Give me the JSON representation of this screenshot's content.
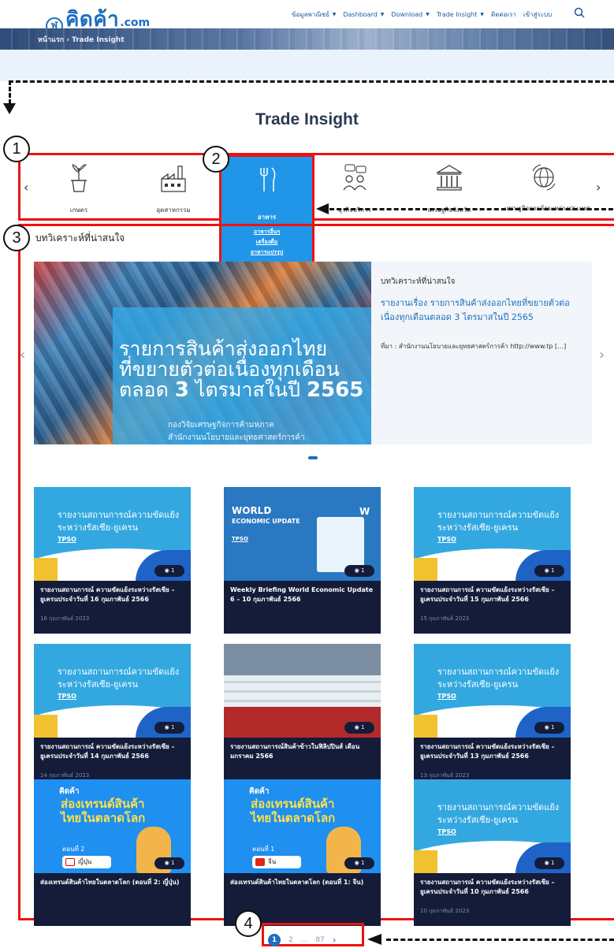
{
  "header": {
    "logo_mark": "ฬ",
    "logo_name": "คิดค้า",
    "logo_domain": ".com",
    "nav": [
      {
        "label": "ข้อมูลพาณิชย์",
        "has_caret": true
      },
      {
        "label": "Dashboard",
        "has_caret": true
      },
      {
        "label": "Download",
        "has_caret": true
      },
      {
        "label": "Trade Insight",
        "has_caret": true
      },
      {
        "label": "ติดต่อเรา",
        "has_caret": false
      },
      {
        "label": "เข้าสู่ระบบ",
        "has_caret": false
      }
    ],
    "search_icon": "search-icon"
  },
  "breadcrumb": {
    "home": "หน้าแรก",
    "sep": "›",
    "current": "Trade Insight"
  },
  "page_title": "Trade Insight",
  "categories": {
    "items": [
      {
        "label": "เกษตร",
        "icon": "plant-icon"
      },
      {
        "label": "อุตสาหกรรม",
        "icon": "factory-icon"
      },
      {
        "label": "อาหาร",
        "icon": "fork-knife-icon",
        "active": true,
        "subitems": [
          "อาหารอื่นๆ",
          "เครื่องดื่ม",
          "อาหารแปรรูป"
        ]
      },
      {
        "label": "ธุรกิจบริการ",
        "icon": "people-chat-icon"
      },
      {
        "label": "เศรษฐกิจจังหวัด",
        "icon": "building-icon"
      },
      {
        "label": "เศรษฐกิจการค้าระหว่างประเทศ",
        "icon": "globe-icon"
      }
    ],
    "prev": "‹",
    "next": "›"
  },
  "annotations": {
    "b1": "1",
    "b2": "2",
    "b3": "3",
    "b4": "4"
  },
  "section_title": "บทวิเคราะห์ที่น่าสนใจ",
  "hero": {
    "line1": "รายการสินค้าส่งออกไทย",
    "line2": "ที่ขยายตัวต่อเนื่องทุกเดือน",
    "line3_pre": "ตลอด ",
    "line3_num": "3",
    "line3_mid": " ไตรมาสในปี ",
    "line3_year": "2565",
    "sub1": "กองวิจัยเศรษฐกิจการค้ามหภาค",
    "sub2": "สำนักงานนโยบายและยุทธศาสตร์การค้า",
    "kicker": "บทวิเคราะห์ที่น่าสนใจ",
    "headline": "รายงานเรื่อง รายการสินค้าส่งออกไทยที่ขยายตัวต่อเนื่องทุกเดือนตลอด 3 ไตรมาสในปี 2565",
    "source": "ที่มา : สำนักงานนโยบายและยุทธศาสตร์การค้า http://www.tp […]",
    "prev": "‹",
    "next": "›"
  },
  "cards": [
    {
      "type": "blue",
      "thumb_line1": "รายงานสถานการณ์ความขัดแย้ง",
      "thumb_line2": "ระหว่างรัสเซีย-ยูเครน",
      "thumb_tag": "TPSO",
      "views": "1",
      "title": "รายงานสถานการณ์ ความขัดแย้งระหว่างรัสเซีย – ยูเครนประจำวันที่ 16 กุมภาพันธ์ 2566",
      "date": "16 กุมภาพันธ์ 2023"
    },
    {
      "type": "world",
      "thumb_line1": "WORLD",
      "thumb_line2": "ECONOMIC UPDATE",
      "thumb_tag": "TPSO",
      "views": "1",
      "title": "Weekly Briefing World Economic Update 6 – 10 กุมภาพันธ์ 2566",
      "date": ""
    },
    {
      "type": "blue",
      "thumb_line1": "รายงานสถานการณ์ความขัดแย้ง",
      "thumb_line2": "ระหว่างรัสเซีย-ยูเครน",
      "thumb_tag": "TPSO",
      "views": "1",
      "title": "รายงานสถานการณ์ ความขัดแย้งระหว่างรัสเซีย – ยูเครนประจำวันที่ 15 กุมภาพันธ์ 2566",
      "date": "15 กุมภาพันธ์ 2023"
    },
    {
      "type": "blue",
      "thumb_line1": "รายงานสถานการณ์ความขัดแย้ง",
      "thumb_line2": "ระหว่างรัสเซีย-ยูเครน",
      "thumb_tag": "TPSO",
      "views": "1",
      "title": "รายงานสถานการณ์ ความขัดแย้งระหว่างรัสเซีย – ยูเครนประจำวันที่ 14 กุมภาพันธ์ 2566",
      "date": "14 กุมภาพันธ์ 2023"
    },
    {
      "type": "rice",
      "views": "1",
      "title": "รายงานสถานการณ์สินค้าข้าวในฟิลิปปินส์ เดือนมกราคม 2566",
      "date": ""
    },
    {
      "type": "blue",
      "thumb_line1": "รายงานสถานการณ์ความขัดแย้ง",
      "thumb_line2": "ระหว่างรัสเซีย-ยูเครน",
      "thumb_tag": "TPSO",
      "views": "1",
      "title": "รายงานสถานการณ์ ความขัดแย้งระหว่างรัสเซีย – ยูเครนประจำวันที่ 13 กุมภาพันธ์ 2566",
      "date": "13 กุมภาพันธ์ 2023"
    },
    {
      "type": "trend",
      "thumb_logo": "คิดค้า",
      "thumb_line1": "ส่องเทรนด์สินค้า",
      "thumb_line2": "ไทยในตลาดโลก",
      "thumb_ep": "ตอนที่ 2",
      "thumb_flag": "ญี่ปุ่น",
      "flag_color": "#ffffff",
      "views": "1",
      "title": "ส่องเทรนด์สินค้าไทยในตลาดโลก (ตอนที่ 2: ญี่ปุ่น)",
      "date": ""
    },
    {
      "type": "trend",
      "thumb_logo": "คิดค้า",
      "thumb_line1": "ส่องเทรนด์สินค้า",
      "thumb_line2": "ไทยในตลาดโลก",
      "thumb_ep": "ตอนที่ 1",
      "thumb_flag": "จีน",
      "flag_color": "#de2910",
      "views": "1",
      "title": "ส่องเทรนด์สินค้าไทยในตลาดโลก (ตอนที่ 1: จีน)",
      "date": ""
    },
    {
      "type": "blue",
      "thumb_line1": "รายงานสถานการณ์ความขัดแย้ง",
      "thumb_line2": "ระหว่างรัสเซีย-ยูเครน",
      "thumb_tag": "TPSO",
      "views": "1",
      "title": "รายงานสถานการณ์ ความขัดแย้งระหว่างรัสเซีย – ยูเครนประจำวันที่ 10 กุมภาพันธ์ 2566",
      "date": "10 กุมภาพันธ์ 2023"
    }
  ],
  "pagination": {
    "current": "1",
    "next_page": "2",
    "ellipsis": "...",
    "last": "87",
    "next": "›"
  },
  "colors": {
    "brand": "#1e6fbf",
    "accent": "#2196e8",
    "annotation": "#e11111",
    "card_bg": "#141c3a"
  }
}
